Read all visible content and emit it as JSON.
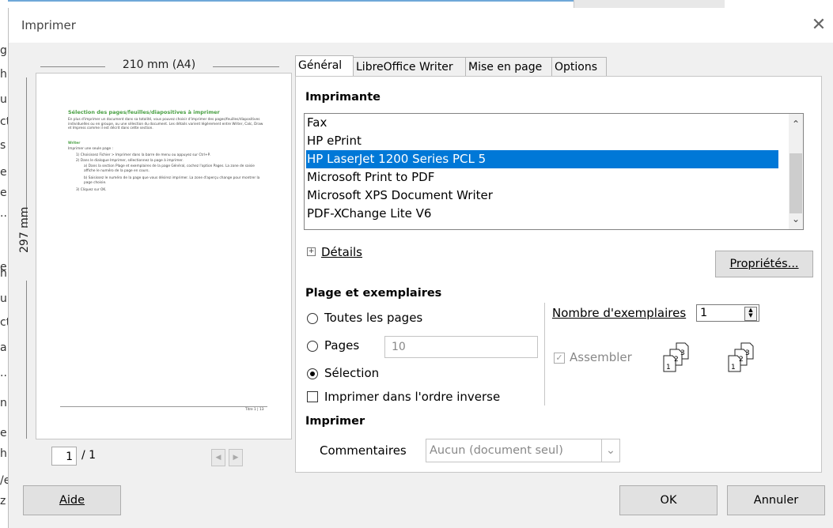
{
  "background_app": {
    "edge_letters": [
      "g",
      "h",
      "u",
      "ct",
      "s",
      "e",
      "e",
      "...",
      "e",
      "h",
      "u",
      "ct",
      "a",
      "...",
      "n",
      "e",
      "h",
      "/e",
      "z"
    ]
  },
  "dialog": {
    "title": "Imprimer",
    "close_glyph": "✕"
  },
  "preview": {
    "width_label": "210 mm (A4)",
    "height_label": "297 mm",
    "page_number": "1",
    "page_total": "/ 1",
    "prev_glyph": "◀",
    "next_glyph": "▶",
    "doc_title": "Sélection des pages/feuilles/diapositives à imprimer",
    "doc_intro": "En plus d'imprimer un document dans sa totalité, vous pouvez choisir d'imprimer des pages/feuilles/diapositives individuelles ou en groupe, ou une sélection du document. Les détails varient légèrement entre Writer, Calc, Draw et Impress comme il est décrit dans cette section.",
    "doc_subtitle": "Writer",
    "doc_line1": "Imprimer une seule page :",
    "doc_step1": "1)   Choisissez Fichier > Imprimer dans la barre de menu ou appuyez sur Ctrl+P.",
    "doc_step2": "2)   Dans le dialogue Imprimer, sélectionnez la page à imprimer.",
    "doc_step2a": "a)   Dans la section Plage et exemplaires de la page Général, cochez l'option Pages. La zone de saisie affiche le numéro de la page en cours.",
    "doc_step2b": "b)   Saisissez le numéro de la page que vous désirez imprimer. La zone d'aperçu change pour montrer la page choisie.",
    "doc_step3": "3)   Cliquez sur OK.",
    "doc_footer": "Titre 1 | 13"
  },
  "tabs": [
    {
      "label": "Général"
    },
    {
      "label": "LibreOffice Writer"
    },
    {
      "label": "Mise en page"
    },
    {
      "label": "Options"
    }
  ],
  "printer_section": {
    "title": "Imprimante",
    "printers": [
      "Fax",
      "HP ePrint",
      "HP LaserJet 1200 Series PCL 5",
      "Microsoft Print to PDF",
      "Microsoft XPS Document Writer",
      "PDF-XChange Lite V6"
    ],
    "selected_index": 2,
    "details_label": "Détails",
    "properties_label": "Propriétés..."
  },
  "range_section": {
    "title": "Plage et exemplaires",
    "all_pages_label": "Toutes les pages",
    "pages_label": "Pages",
    "pages_value": "10",
    "selection_label": "Sélection",
    "reverse_label": "Imprimer dans l'ordre inverse",
    "copies_label": "Nombre d'exemplaires",
    "copies_value": "1",
    "collate_label": "Assembler",
    "selected_option": "selection"
  },
  "print_section": {
    "title": "Imprimer",
    "comments_label": "Commentaires",
    "comments_value": "Aucun (document seul)"
  },
  "buttons": {
    "help": "Aide",
    "ok": "OK",
    "cancel": "Annuler"
  },
  "colors": {
    "selection": "#0078d7",
    "preview_title": "#49a043",
    "dialog_bg": "#f0f0f0"
  }
}
